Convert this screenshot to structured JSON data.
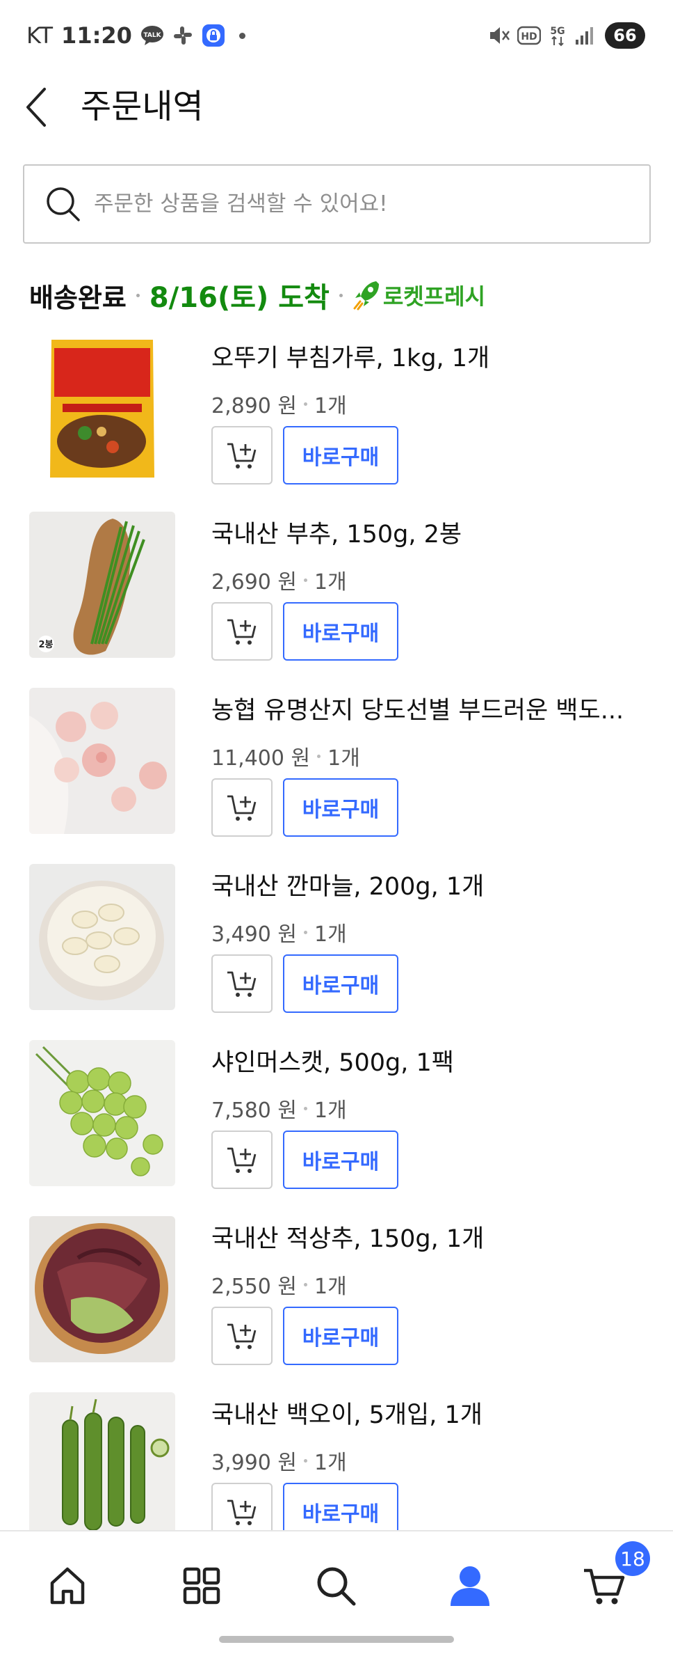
{
  "status_bar": {
    "carrier": "KT",
    "time": "11:20",
    "battery": "66",
    "icons": [
      "talk-icon",
      "slack-icon",
      "vpn-lock-icon",
      "notification-dot",
      "mute-icon",
      "hd-icon",
      "5g-icon",
      "signal-icon",
      "battery-icon"
    ]
  },
  "header": {
    "title": "주문내역",
    "back_icon": "chevron-left-icon"
  },
  "search": {
    "placeholder": "주문한 상품을 검색할 수 있어요!",
    "value": ""
  },
  "delivery": {
    "status": "배송완료",
    "date": "8/16(토) 도착",
    "badge": "로켓프레시",
    "date_color": "#138a0f",
    "badge_color": "#2fa324"
  },
  "items": [
    {
      "name": "오뚜기 부침가루, 1kg, 1개",
      "price": "2,890 원",
      "qty": "1개",
      "buy_label": "바로구매",
      "thumb": "pancake-mix-bag",
      "thumb_badge": ""
    },
    {
      "name": "국내산 부추, 150g, 2봉",
      "price": "2,690 원",
      "qty": "1개",
      "buy_label": "바로구매",
      "thumb": "chives-on-board",
      "thumb_badge": "2봉"
    },
    {
      "name": "농협 유명산지 당도선별 부드러운 백도...",
      "price": "11,400 원",
      "qty": "1개",
      "buy_label": "바로구매",
      "thumb": "white-peaches",
      "thumb_badge": ""
    },
    {
      "name": "국내산 깐마늘, 200g, 1개",
      "price": "3,490 원",
      "qty": "1개",
      "buy_label": "바로구매",
      "thumb": "peeled-garlic-bowl",
      "thumb_badge": ""
    },
    {
      "name": "샤인머스캣, 500g, 1팩",
      "price": "7,580 원",
      "qty": "1개",
      "buy_label": "바로구매",
      "thumb": "shine-muscat-grapes",
      "thumb_badge": ""
    },
    {
      "name": "국내산 적상추, 150g, 1개",
      "price": "2,550 원",
      "qty": "1개",
      "buy_label": "바로구매",
      "thumb": "red-lettuce-bowl",
      "thumb_badge": ""
    },
    {
      "name": "국내산 백오이, 5개입, 1개",
      "price": "3,990 원",
      "qty": "1개",
      "buy_label": "바로구매",
      "thumb": "cucumbers",
      "thumb_badge": ""
    }
  ],
  "bottom_nav": {
    "items": [
      "home-icon",
      "category-grid-icon",
      "search-icon",
      "my-account-icon",
      "cart-icon"
    ],
    "active": "my-account-icon",
    "cart_count": "18",
    "accent": "#346aff"
  }
}
